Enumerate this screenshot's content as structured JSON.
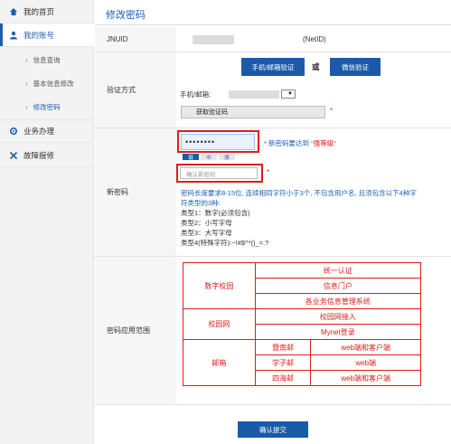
{
  "sidebar": {
    "items": [
      {
        "label": "我的首页",
        "icon": "home-icon"
      },
      {
        "label": "我的账号",
        "icon": "user-icon",
        "active": true
      },
      {
        "label": "信息查询"
      },
      {
        "label": "基本信息修改"
      },
      {
        "label": "修改密码",
        "active": true
      },
      {
        "label": "业务办理",
        "icon": "gear-icon"
      },
      {
        "label": "故障报修",
        "icon": "tools-icon"
      }
    ]
  },
  "main": {
    "title": "修改密码",
    "jnuid": {
      "label": "JNUID",
      "suffix": "(NetID)"
    },
    "verify": {
      "label": "验证方式",
      "btn_phone_email": "手机/邮箱验证",
      "or": "或",
      "btn_wechat": "微信验证",
      "phone_email_label": "手机/邮箱:",
      "get_code_btn": "获取验证码",
      "star": "*"
    },
    "new_password": {
      "label": "新密码",
      "value": "••••••••",
      "hint_prefix": "* 新密码要达到 “",
      "hint_strong": "强等级",
      "hint_suffix": "”",
      "strength": [
        "弱",
        "中",
        "强"
      ],
      "confirm_placeholder": "确认新密码",
      "confirm_star": "*",
      "rules_line1": "密码长度要求8-15位, 连续相同字符小于3个, 不包含用户名, 且须包含以下4种字",
      "rules_line2": "符类型的3种:",
      "type1": "类型1：数字(必须包含)",
      "type2": "类型2：小写字母",
      "type3": "类型3：大写字母",
      "type4": "类型4(特殊字符):~!#$^*()_=.?"
    },
    "scope": {
      "label": "密码应用范围",
      "groups": [
        {
          "name": "数字校园",
          "items": [
            "统一认证",
            "信息门户",
            "各业务信息管理系统"
          ]
        },
        {
          "name": "校园网",
          "items": [
            "校园网接入",
            "Mynet登录"
          ]
        },
        {
          "name": "邮箱",
          "rows": [
            {
              "sub": "暨南邮",
              "value": "web端和客户端"
            },
            {
              "sub": "学子邮",
              "value": "web端"
            },
            {
              "sub": "四海邮",
              "value": "web端和客户端"
            }
          ]
        }
      ]
    },
    "submit": "确认提交"
  },
  "colors": {
    "accent": "#1b5fb3",
    "button": "#1a5ba8",
    "highlight_red": "#e01c1c"
  }
}
